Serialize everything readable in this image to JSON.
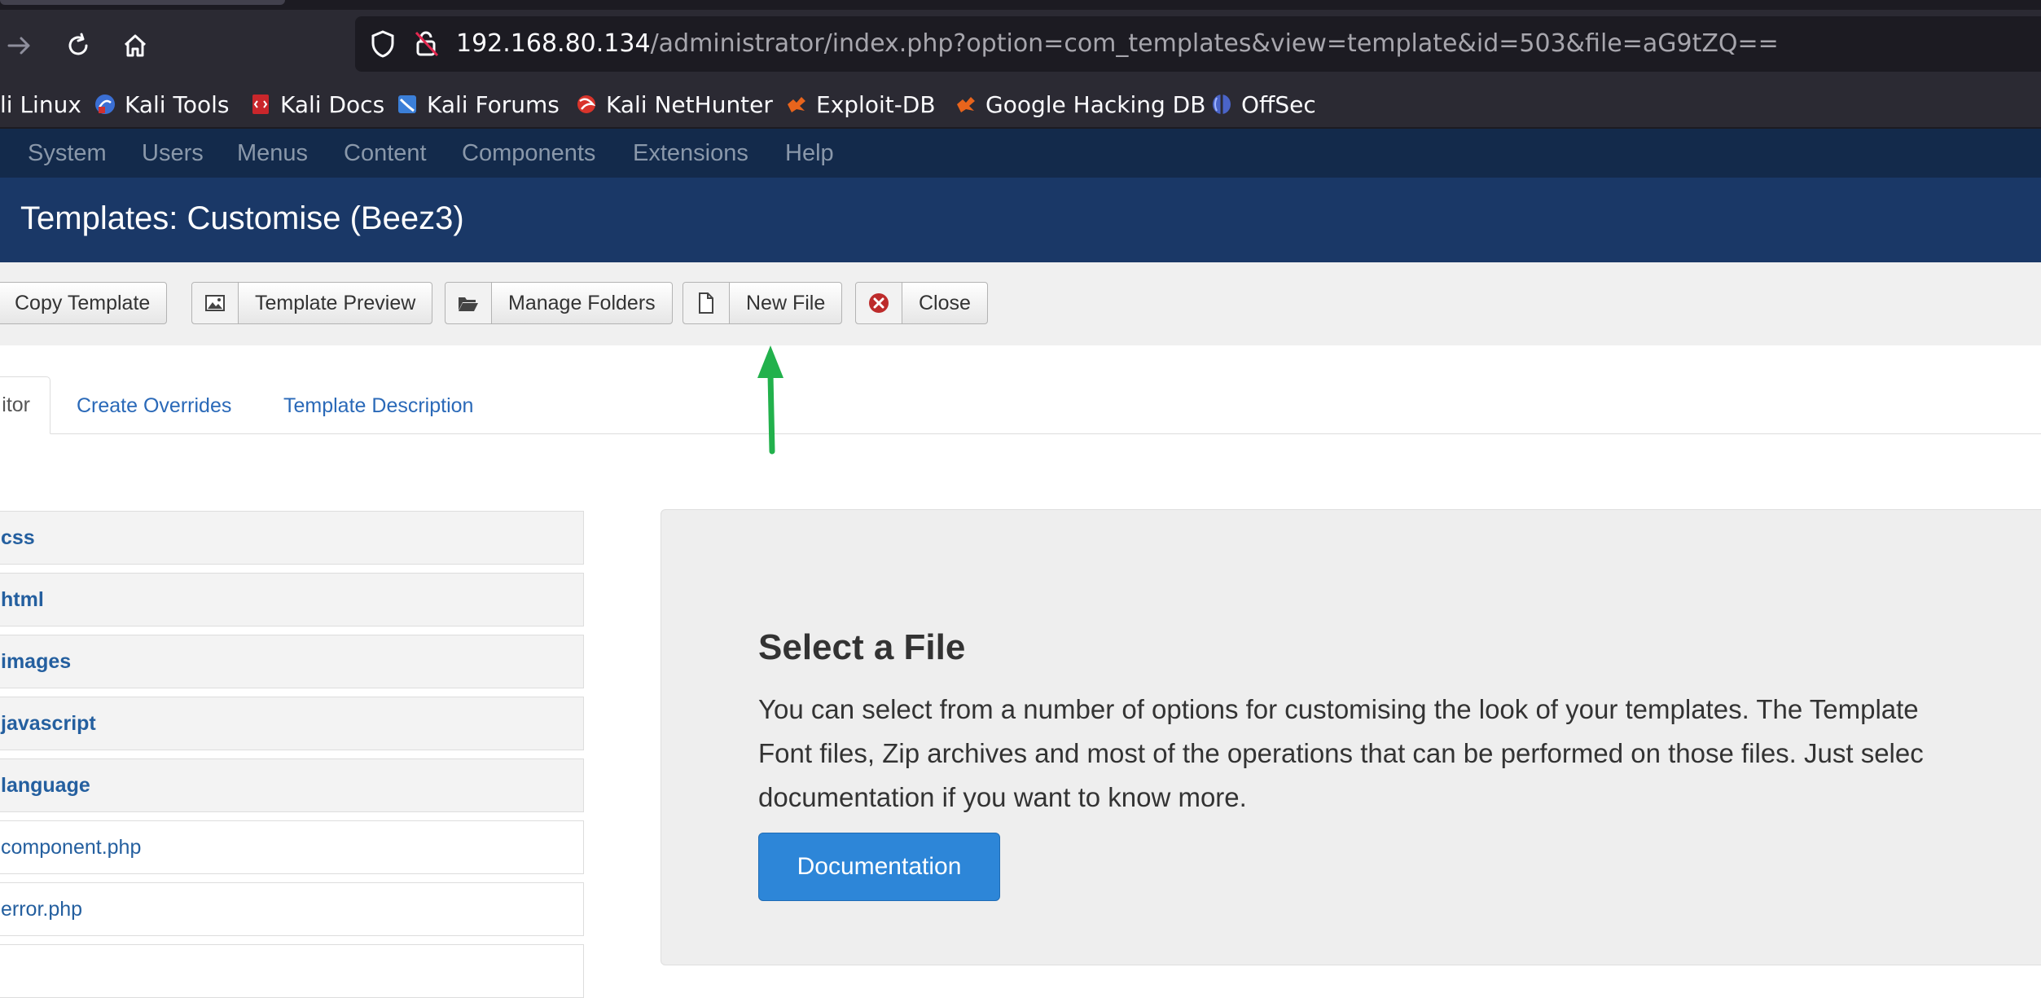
{
  "browser": {
    "url_host": "192.168.80.134",
    "url_path": "/administrator/index.php?option=com_templates&view=template&id=503&file=aG9tZQ==",
    "bookmarks": [
      {
        "label": "li Linux",
        "icon": "kali-linux-icon"
      },
      {
        "label": "Kali Tools",
        "icon": "kali-tools-icon"
      },
      {
        "label": "Kali Docs",
        "icon": "kali-docs-icon"
      },
      {
        "label": "Kali Forums",
        "icon": "kali-forums-icon"
      },
      {
        "label": "Kali NetHunter",
        "icon": "kali-nethunter-icon"
      },
      {
        "label": "Exploit-DB",
        "icon": "exploit-db-icon"
      },
      {
        "label": "Google Hacking DB",
        "icon": "google-hacking-db-icon"
      },
      {
        "label": "OffSec",
        "icon": "offsec-icon"
      }
    ]
  },
  "menu": {
    "items": [
      "System",
      "Users",
      "Menus",
      "Content",
      "Components",
      "Extensions",
      "Help"
    ]
  },
  "page": {
    "title": "Templates: Customise (Beez3)"
  },
  "toolbar": {
    "buttons": [
      {
        "label": "Copy Template",
        "icon": "copy-icon"
      },
      {
        "label": "Template Preview",
        "icon": "image-icon"
      },
      {
        "label": "Manage Folders",
        "icon": "folder-icon"
      },
      {
        "label": "New File",
        "icon": "file-icon"
      },
      {
        "label": "Close",
        "icon": "close-circle-icon"
      }
    ]
  },
  "tabs": {
    "active_label": "itor",
    "links": [
      "Create Overrides",
      "Template Description"
    ]
  },
  "file_tree": {
    "folders": [
      "css",
      "html",
      "images",
      "javascript",
      "language"
    ],
    "files": [
      "component.php",
      "error.php"
    ]
  },
  "panel": {
    "title": "Select a File",
    "text_lines": [
      "You can select from a number of options for customising the look of your templates. The Template",
      "Font files, Zip archives and most of the operations that can be performed on those files. Just selec",
      "documentation if you want to know more."
    ],
    "button_label": "Documentation"
  },
  "annotation": {
    "arrow_color": "#22b14c"
  },
  "colors": {
    "menubar": "#132a4b",
    "titlebar": "#1a3867",
    "link": "#2a69b8",
    "primary_button": "#2d86d8"
  }
}
